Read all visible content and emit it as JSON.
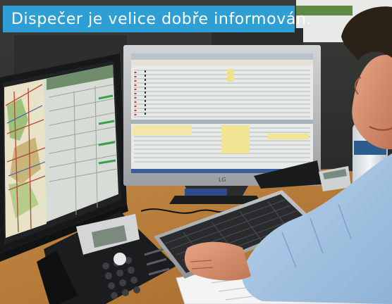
{
  "caption": {
    "text": "Dispečer je velice dobře informován."
  },
  "monitor_brand": "LG",
  "colors": {
    "caption_background": "#2e9fd4",
    "caption_text": "#ffffff",
    "desk": "#c8893f",
    "shirt": "#9ec1e2",
    "monitor_frame": "#b9bbbe",
    "screen": "#e7ebe8"
  }
}
